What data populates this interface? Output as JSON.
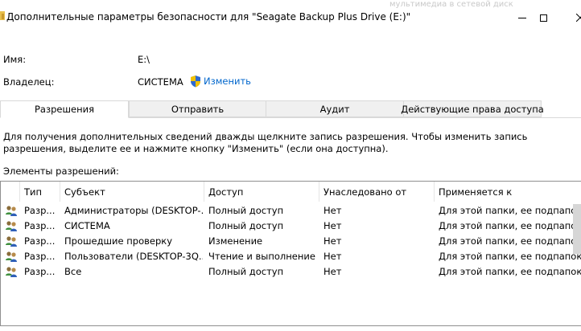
{
  "window": {
    "title": "Дополнительные параметры безопасности  для \"Seagate Backup Plus Drive (E:)\"",
    "background_text": "мультимедиа в сетевой диск"
  },
  "info": {
    "name_label": "Имя:",
    "name_value": "E:\\",
    "owner_label": "Владелец:",
    "owner_value": "СИСТЕМА",
    "change_label": "Изменить"
  },
  "tabs": [
    {
      "label": "Разрешения",
      "active": true
    },
    {
      "label": "Отправить",
      "active": false
    },
    {
      "label": "Аудит",
      "active": false
    },
    {
      "label": "Действующие права доступа",
      "active": false
    }
  ],
  "description": "Для получения дополнительных сведений дважды щелкните запись разрешения. Чтобы изменить запись разрешения, выделите ее и нажмите кнопку \"Изменить\" (если она доступна).",
  "permissions_label": "Элементы разрешений:",
  "table": {
    "columns": [
      "Тип",
      "Субъект",
      "Доступ",
      "Унаследовано от",
      "Применяется к"
    ],
    "rows": [
      [
        "Разр...",
        "Администраторы (DESKTOP-...",
        "Полный доступ",
        "Нет",
        "Для этой папки, ее подпапок ..."
      ],
      [
        "Разр...",
        "СИСТЕМА",
        "Полный доступ",
        "Нет",
        "Для этой папки, ее подпапок ..."
      ],
      [
        "Разр...",
        "Прошедшие проверку",
        "Изменение",
        "Нет",
        "Для этой папки, ее подпапок ..."
      ],
      [
        "Разр...",
        "Пользователи (DESKTOP-3Q...",
        "Чтение и выполнение",
        "Нет",
        "Для этой папки, ее подпапок ..."
      ],
      [
        "Разр...",
        "Все",
        "Полный доступ",
        "Нет",
        "Для этой папки, ее подпапок ..."
      ]
    ]
  },
  "icons": {
    "minimize": "minimize-icon",
    "maximize": "maximize-icon",
    "close": "close-icon",
    "shield": "uac-shield-icon",
    "user": "users-icon"
  },
  "colors": {
    "link": "#0066cc",
    "tab_inactive": "#f0f0f0",
    "border": "#d9d9d9"
  }
}
